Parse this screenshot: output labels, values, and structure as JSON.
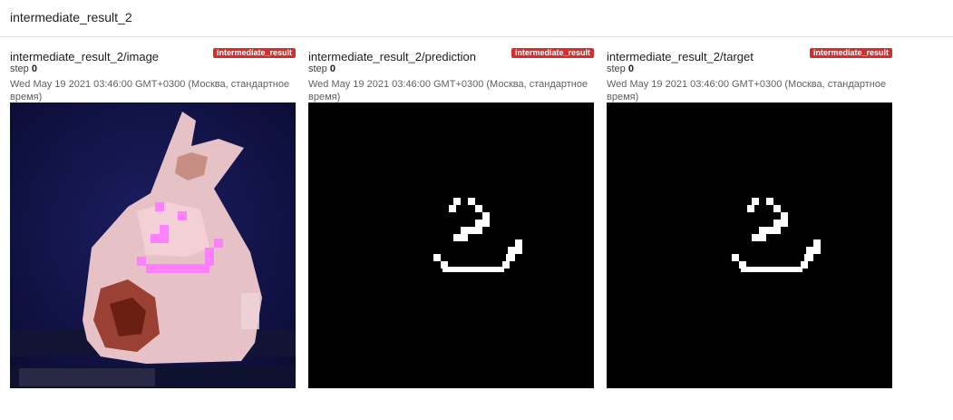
{
  "section": {
    "title": "intermediate_result_2"
  },
  "cards": [
    {
      "title": "intermediate_result_2/image",
      "run": "intermediate_result",
      "step_label": "step",
      "step_value": "0",
      "wall_time": "Wed May 19 2021 03:46:00 GMT+0300 (Москва, стандартное время)"
    },
    {
      "title": "intermediate_result_2/prediction",
      "run": "intermediate_result",
      "step_label": "step",
      "step_value": "0",
      "wall_time": "Wed May 19 2021 03:46:00 GMT+0300 (Москва, стандартное время)"
    },
    {
      "title": "intermediate_result_2/target",
      "run": "intermediate_result",
      "step_label": "step",
      "step_value": "0",
      "wall_time": "Wed May 19 2021 03:46:00 GMT+0300 (Москва, стандартное время)"
    }
  ],
  "colors": {
    "run_badge": "#d32f2f",
    "mask_background": "#000000",
    "mask_foreground": "#ffffff"
  }
}
